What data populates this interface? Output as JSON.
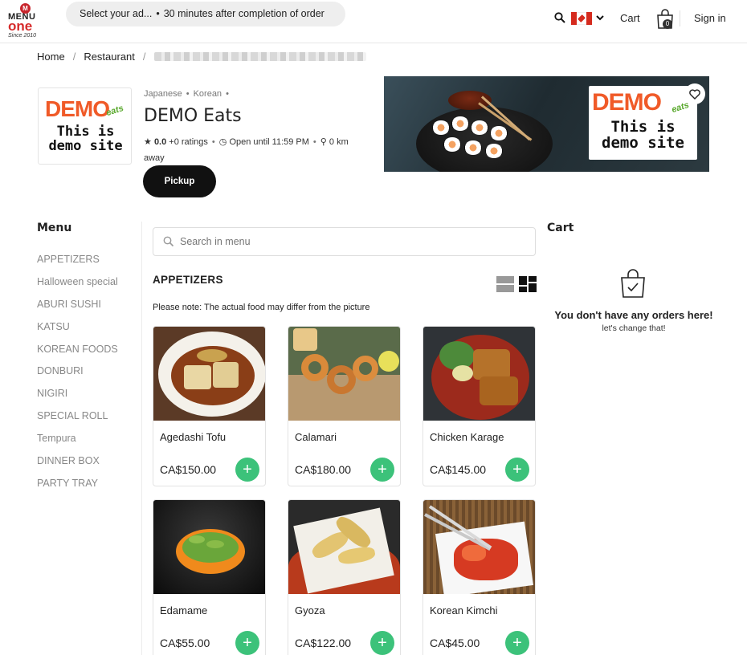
{
  "header": {
    "logo": {
      "badge": "M",
      "line1": "MENU",
      "line2": "one",
      "line3": "Since 2010"
    },
    "address_pill": {
      "address": "Select your ad...",
      "separator": "•",
      "timing": "30 minutes after completion of order"
    },
    "cart_label": "Cart",
    "cart_count": "0",
    "signin_label": "Sign in"
  },
  "breadcrumb": {
    "home": "Home",
    "restaurant": "Restaurant",
    "sep": "/"
  },
  "restaurant": {
    "logo": {
      "brand": "DEMO",
      "sub": "eats",
      "line1": "This is",
      "line2": "demo site"
    },
    "cuisines": [
      "Japanese",
      "Korean"
    ],
    "cuisine_sep": "•",
    "name": "DEMO Eats",
    "rating": "0.0",
    "ratings_count": "+0 ratings",
    "hours": "Open until 11:59 PM",
    "distance": "0 km away",
    "pickup_label": "Pickup",
    "banner_card": {
      "brand": "DEMO",
      "sub": "eats",
      "line1": "This is",
      "line2": "demo site"
    }
  },
  "menu": {
    "title": "Menu",
    "items": [
      "APPETIZERS",
      "Halloween special",
      "ABURI SUSHI",
      "KATSU",
      "KOREAN FOODS",
      "DONBURI",
      "NIGIRI",
      "SPECIAL ROLL",
      "Tempura",
      "DINNER BOX",
      "PARTY TRAY"
    ]
  },
  "main": {
    "search_placeholder": "Search in menu",
    "section_title": "APPETIZERS",
    "note": "Please note: The actual food may differ from the picture",
    "products": [
      {
        "name": "Agedashi Tofu",
        "price": "CA$150.00",
        "add": "+"
      },
      {
        "name": "Calamari",
        "price": "CA$180.00",
        "add": "+"
      },
      {
        "name": "Chicken Karage",
        "price": "CA$145.00",
        "add": "+"
      },
      {
        "name": "Edamame",
        "price": "CA$55.00",
        "add": "+"
      },
      {
        "name": "Gyoza",
        "price": "CA$122.00",
        "add": "+"
      },
      {
        "name": "Korean Kimchi",
        "price": "CA$45.00",
        "add": "+"
      }
    ]
  },
  "cart": {
    "title": "Cart",
    "empty_title": "You don't have any orders here!",
    "empty_sub": "let's change that!"
  },
  "colors": {
    "accent_green": "#3cc27a",
    "logo_red": "#d62b2b",
    "demo_orange": "#f05a28",
    "eats_green": "#5aa92e"
  }
}
